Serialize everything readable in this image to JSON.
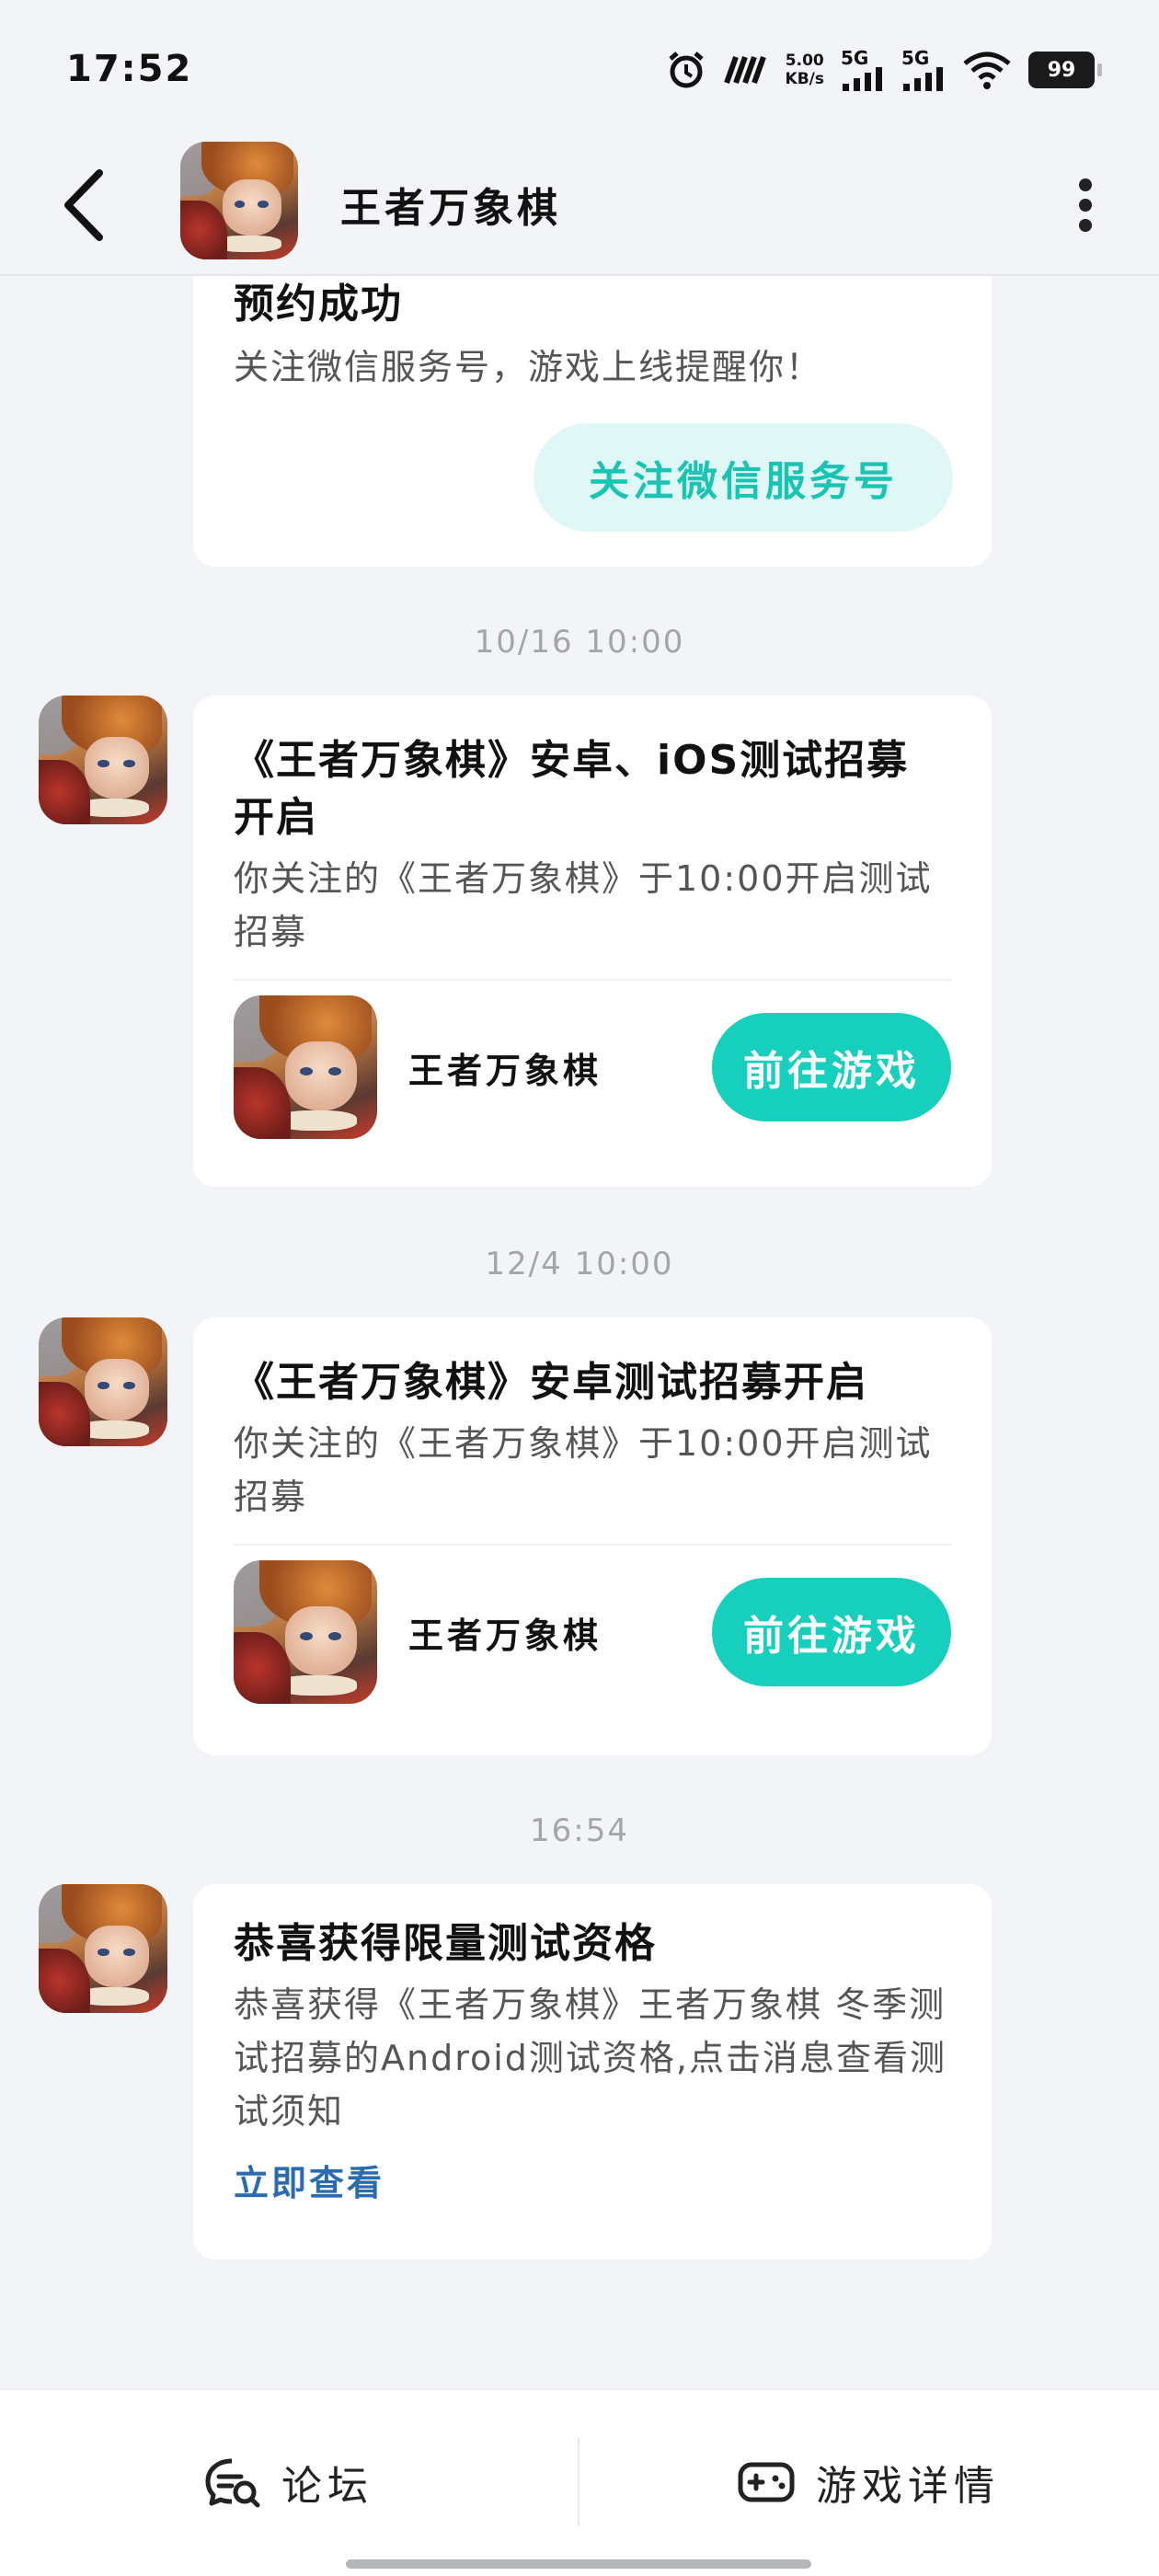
{
  "status_bar": {
    "time": "17:52",
    "net_speed_value": "5.00",
    "net_speed_unit": "KB/s",
    "sim1": "5G",
    "sim2": "5G",
    "battery": "99"
  },
  "header": {
    "title": "王者万象棋"
  },
  "messages": [
    {
      "title": "预约成功",
      "body": "关注微信服务号，游戏上线提醒你！",
      "button": "关注微信服务号"
    },
    {
      "timestamp": "10/16  10:00",
      "title": "《王者万象棋》安卓、iOS测试招募开启",
      "body": "你关注的《王者万象棋》于10:00开启测试招募",
      "game_name": "王者万象棋",
      "button": "前往游戏"
    },
    {
      "timestamp": "12/4  10:00",
      "title": "《王者万象棋》安卓测试招募开启",
      "body": "你关注的《王者万象棋》于10:00开启测试招募",
      "game_name": "王者万象棋",
      "button": "前往游戏"
    },
    {
      "timestamp": "16:54",
      "title": "恭喜获得限量测试资格",
      "body": "恭喜获得《王者万象棋》王者万象棋 冬季测试招募的Android测试资格,点击消息查看测试须知",
      "link": "立即查看"
    }
  ],
  "bottom_bar": {
    "tabs": [
      {
        "label": "论坛",
        "icon": "forum-chat-icon"
      },
      {
        "label": "游戏详情",
        "icon": "gamepad-icon"
      }
    ]
  },
  "colors": {
    "accent": "#17cfbd",
    "accent_light": "#e0f8f5",
    "link": "#2b6cb0",
    "background": "#f3f4f7"
  }
}
